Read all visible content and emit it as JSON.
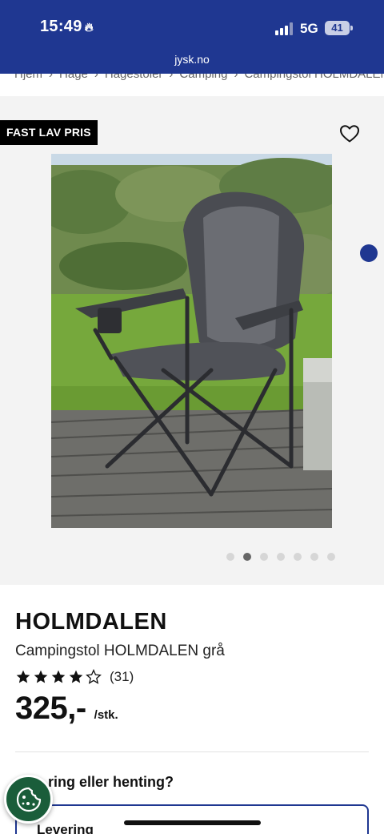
{
  "status_bar": {
    "time": "15:49",
    "network": "5G",
    "battery": "41",
    "url": "jysk.no"
  },
  "breadcrumb": [
    "Hjem",
    "Hage",
    "Hagestoler",
    "Camping",
    "Campingstol HOLMDALEN"
  ],
  "gallery": {
    "badge": "FAST LAV PRIS",
    "image_count": 7,
    "active_index": 1
  },
  "product": {
    "brand": "HOLMDALEN",
    "name": "Campingstol HOLMDALEN grå",
    "rating": 4,
    "rating_max": 5,
    "review_count": "(31)",
    "price": "325,-",
    "unit": "/stk."
  },
  "delivery": {
    "question": "ring eller henting?",
    "option_label": "Levering"
  },
  "colors": {
    "brand_blue": "#1f3791",
    "cookie_green": "#1a5d3a"
  }
}
